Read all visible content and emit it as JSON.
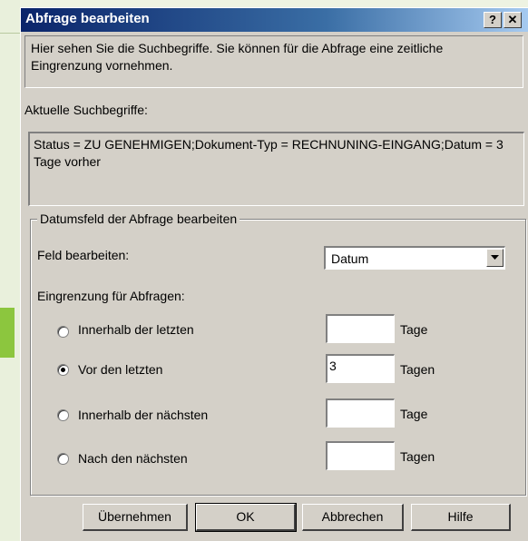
{
  "window": {
    "title": "Abfrage bearbeiten",
    "help_glyph": "?",
    "close_glyph": "✕"
  },
  "intro": "Hier sehen Sie die Suchbegriffe. Sie können für die Abfrage eine zeitliche Eingrenzung vornehmen.",
  "terms": {
    "label": "Aktuelle Suchbegriffe:",
    "value": "Status = ZU GENEHMIGEN;Dokument-Typ = RECHNUNING-EINGANG;Datum = 3 Tage vorher"
  },
  "group": {
    "title": "Datumsfeld der Abfrage bearbeiten",
    "field_label": "Feld bearbeiten:",
    "field_value": "Datum",
    "restriction_label": "Eingrenzung für Abfragen:",
    "options": [
      {
        "label": "Innerhalb der letzten",
        "value": "",
        "unit": "Tage",
        "selected": false
      },
      {
        "label": "Vor den letzten",
        "value": "3",
        "unit": "Tagen",
        "selected": true
      },
      {
        "label": "Innerhalb der nächsten",
        "value": "",
        "unit": "Tage",
        "selected": false
      },
      {
        "label": "Nach den nächsten",
        "value": "",
        "unit": "Tagen",
        "selected": false
      }
    ]
  },
  "buttons": {
    "apply": "Übernehmen",
    "ok": "OK",
    "cancel": "Abbrechen",
    "help": "Hilfe"
  },
  "colors": {
    "titlebar": "#0a246a",
    "dialog_bg": "#d4d0c8",
    "accent_green": "#8cc63e"
  }
}
